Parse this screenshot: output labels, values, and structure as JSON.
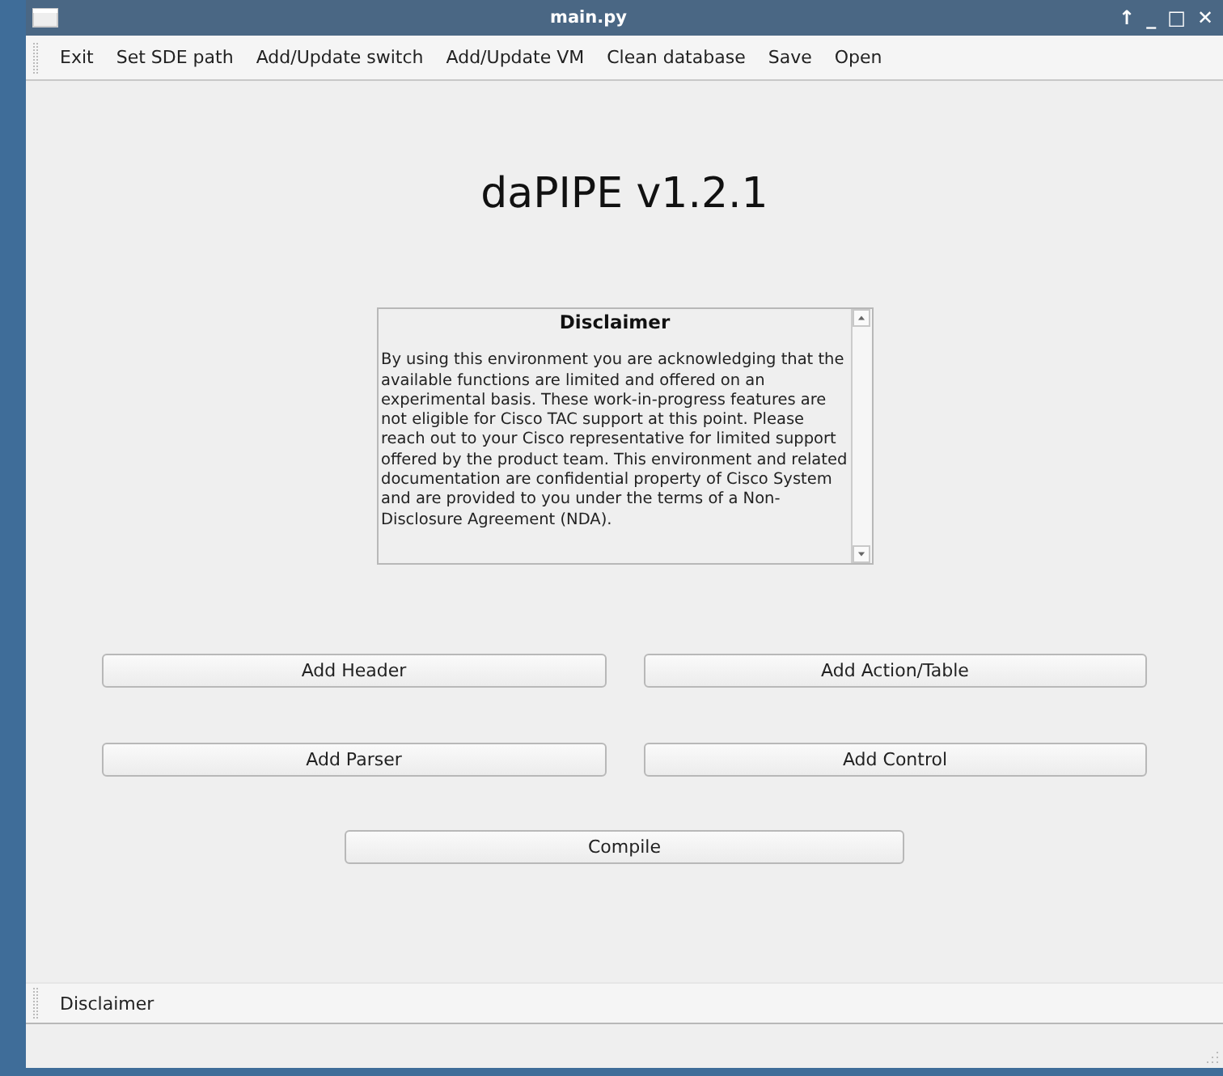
{
  "window": {
    "title": "main.py",
    "controls": [
      "↑",
      "_",
      "□",
      "✕"
    ]
  },
  "menu": [
    "Exit",
    "Set SDE path",
    "Add/Update switch",
    "Add/Update VM",
    "Clean database",
    "Save",
    "Open"
  ],
  "heading": "daPIPE v1.2.1",
  "disclaimer": {
    "title": "Disclaimer",
    "text": "By using this environment you are acknowledging that the available functions are limited and offered on an experimental basis. These work-in-progress features are not eligible for Cisco TAC support at this point. Please reach out to your Cisco representative for limited support offered by the product team. This environment and related documentation are confidential property of Cisco System and are provided to you under the terms of a Non-Disclosure Agreement (NDA)."
  },
  "button_rows": [
    [
      "Add Header",
      "Add Action/Table"
    ],
    [
      "Add Parser",
      "Add Control"
    ]
  ],
  "compile_button": "Compile",
  "toolbar": [
    "Disclaimer"
  ]
}
